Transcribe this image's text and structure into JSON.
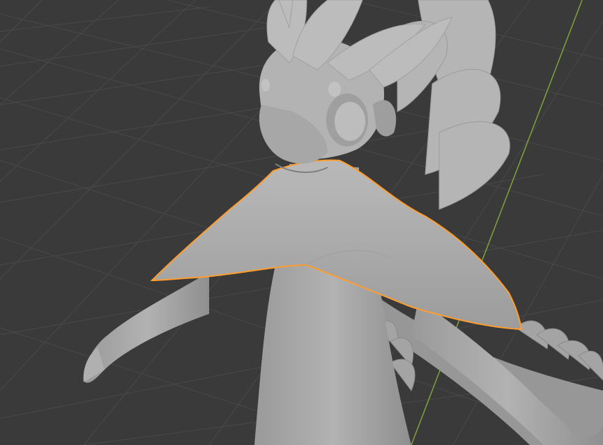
{
  "viewport": {
    "background": "#3a3a3a",
    "grid_color": "#4a4a4a",
    "y_axis_color": "#7ea43a",
    "model_fill": "#a9a9a9",
    "model_shadow": "#8e8e8e",
    "selection_outline": "#ff9d2e"
  },
  "scene": {
    "selected_object": "cape",
    "view": "perspective"
  }
}
